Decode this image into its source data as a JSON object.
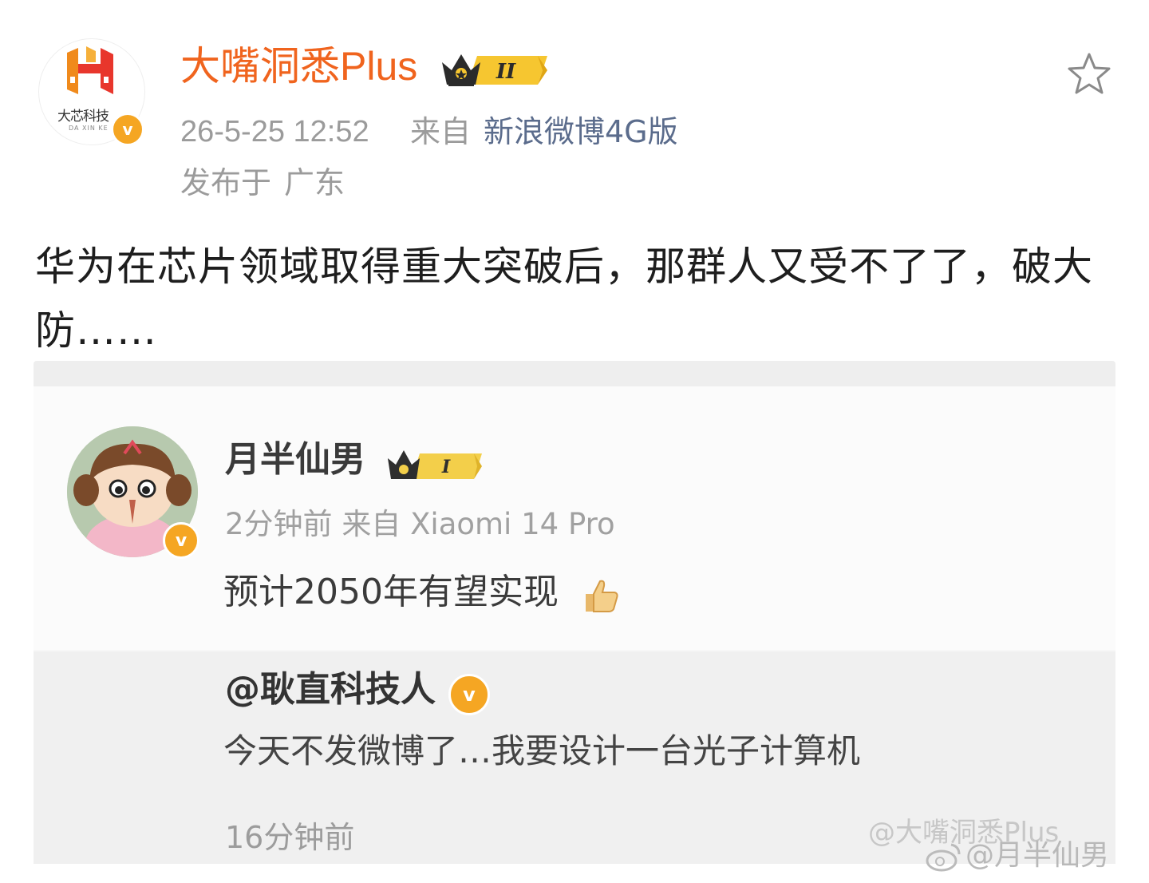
{
  "post": {
    "author": {
      "name": "大嘴洞悉Plus",
      "avatar_text": "大芯科技",
      "avatar_subtext": "DA XIN KE",
      "verified_icon": "v-badge-icon",
      "level": "II"
    },
    "time": "26-5-25 12:52",
    "from_label": "来自",
    "source": "新浪微博4G版",
    "location_label": "发布于",
    "location": "广东",
    "text": "华为在芯片领域取得重大突破后，那群人又受不了了，破大防……"
  },
  "embedded": {
    "author": {
      "name": "月半仙男",
      "level": "I",
      "verified_icon": "v-badge-icon"
    },
    "time": "2分钟前",
    "from_label": "来自",
    "device": "Xiaomi 14 Pro",
    "comment": "预计2050年有望实现",
    "quote": {
      "mention": "@耿直科技人",
      "text": "今天不发微博了…我要设计一台光子计算机",
      "time": "16分钟前"
    }
  },
  "watermarks": {
    "w1": "@大嘴洞悉Plus",
    "w2": "@月半仙男"
  },
  "colors": {
    "username": "#f0641e",
    "source_link": "#5b6c8c",
    "meta_gray": "#9b9b9b",
    "verified": "#f5a623"
  }
}
